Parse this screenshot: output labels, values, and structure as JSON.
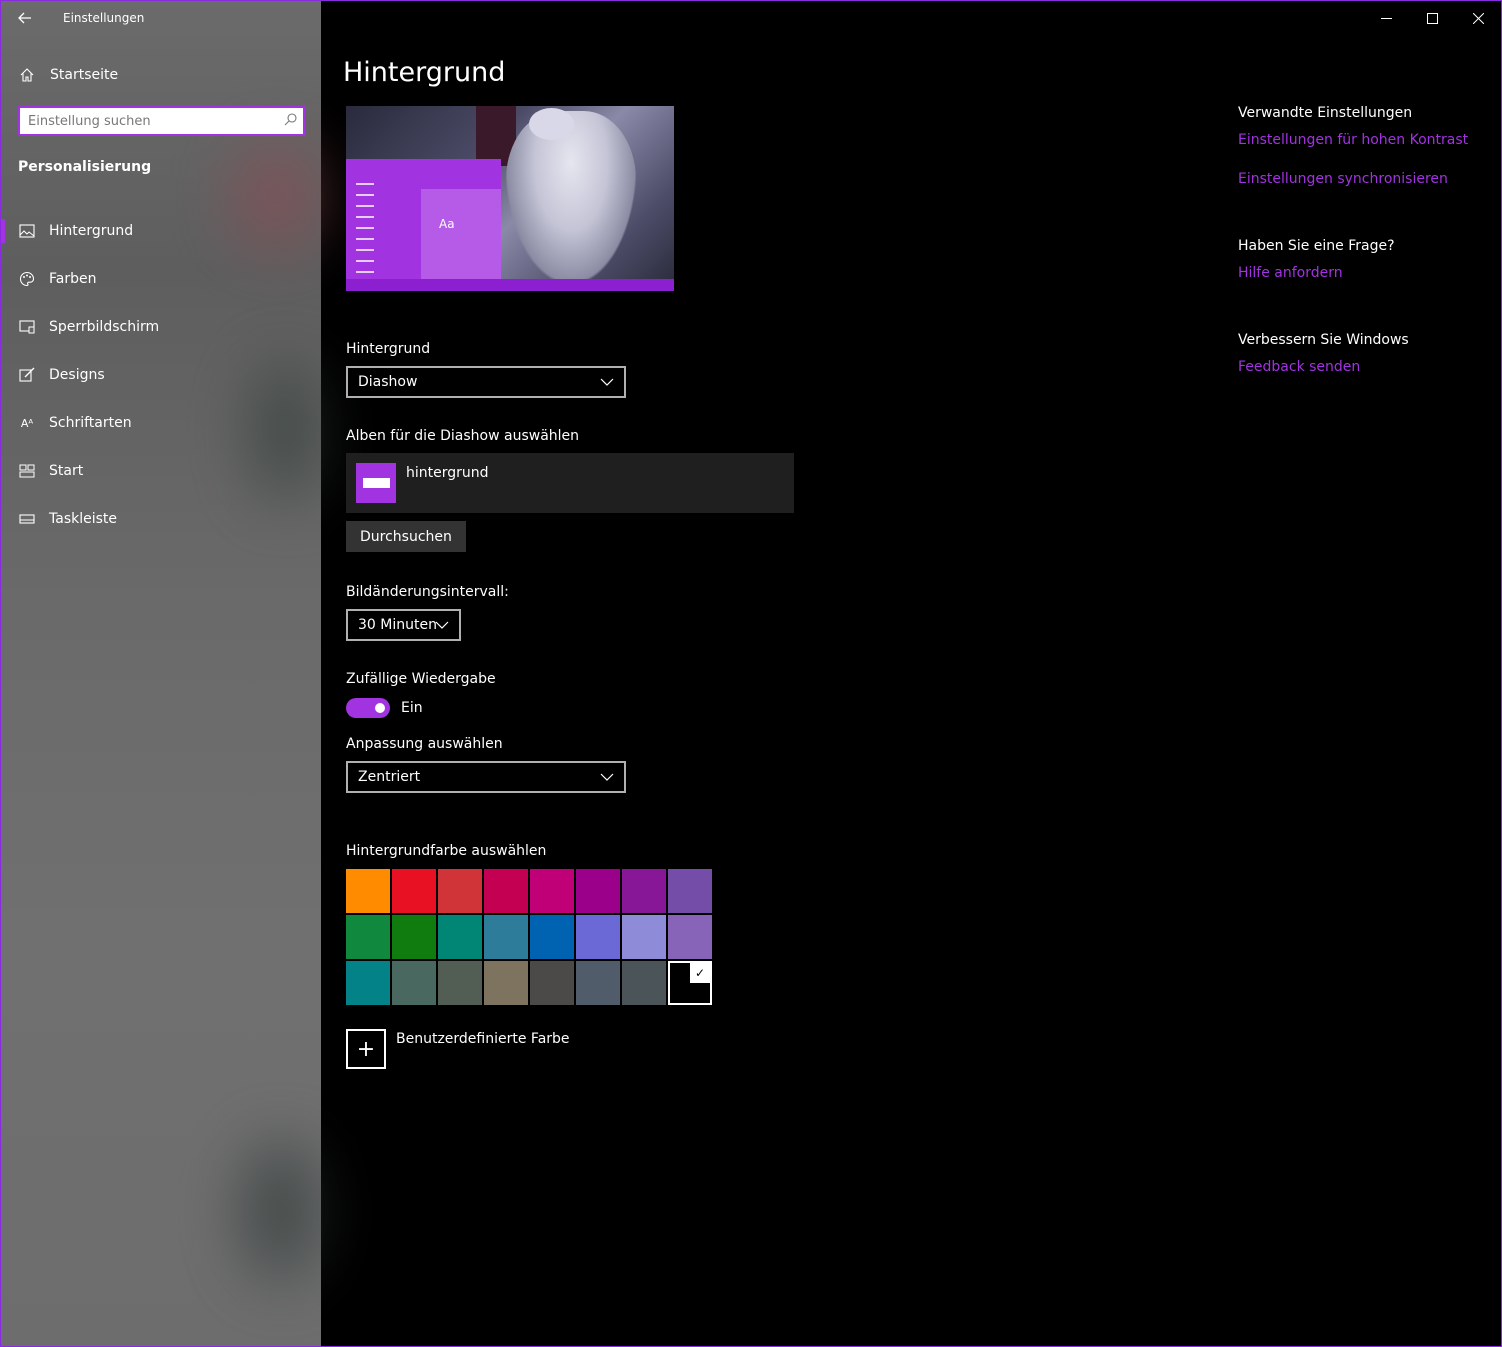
{
  "window": {
    "title": "Einstellungen",
    "controls": {
      "minimize": "─",
      "maximize": "☐",
      "close": "✕"
    }
  },
  "sidebar": {
    "home_label": "Startseite",
    "search_placeholder": "Einstellung suchen",
    "section_title": "Personalisierung",
    "items": [
      {
        "label": "Hintergrund",
        "icon": "image-icon",
        "active": true
      },
      {
        "label": "Farben",
        "icon": "palette-icon"
      },
      {
        "label": "Sperrbildschirm",
        "icon": "lockscreen-icon"
      },
      {
        "label": "Designs",
        "icon": "designs-brush-icon"
      },
      {
        "label": "Schriftarten",
        "icon": "font-icon"
      },
      {
        "label": "Start",
        "icon": "start-tiles-icon"
      },
      {
        "label": "Taskleiste",
        "icon": "taskbar-icon"
      }
    ]
  },
  "main": {
    "title": "Hintergrund",
    "preview_tile_text": "Aa",
    "background_label": "Hintergrund",
    "background_value": "Diashow",
    "albums_label": "Alben für die Diashow auswählen",
    "album_name": "hintergrund",
    "browse_label": "Durchsuchen",
    "interval_label": "Bildänderungsintervall:",
    "interval_value": "30 Minuten",
    "shuffle_label": "Zufällige Wiedergabe",
    "shuffle_state": "Ein",
    "fit_label": "Anpassung auswählen",
    "fit_value": "Zentriert",
    "color_label": "Hintergrundfarbe auswählen",
    "colors": [
      "#ff8c00",
      "#e81123",
      "#d13438",
      "#c30052",
      "#bf0077",
      "#9a0089",
      "#881798",
      "#744da9",
      "#10893e",
      "#107c10",
      "#018574",
      "#2d7d9a",
      "#0063b1",
      "#6b69d6",
      "#8e8cd8",
      "#8764b8",
      "#038387",
      "#486860",
      "#525e54",
      "#7e735f",
      "#4c4a48",
      "#515c6b",
      "#4a5459",
      "#000000"
    ],
    "selected_color_index": 23,
    "custom_color_label": "Benutzerdefinierte Farbe"
  },
  "right": {
    "related_title": "Verwandte Einstellungen",
    "link_contrast": "Einstellungen für hohen Kontrast",
    "link_sync": "Einstellungen synchronisieren",
    "question_title": "Haben Sie eine Frage?",
    "link_help": "Hilfe anfordern",
    "improve_title": "Verbessern Sie Windows",
    "link_feedback": "Feedback senden"
  },
  "accent_color": "#a133e0"
}
